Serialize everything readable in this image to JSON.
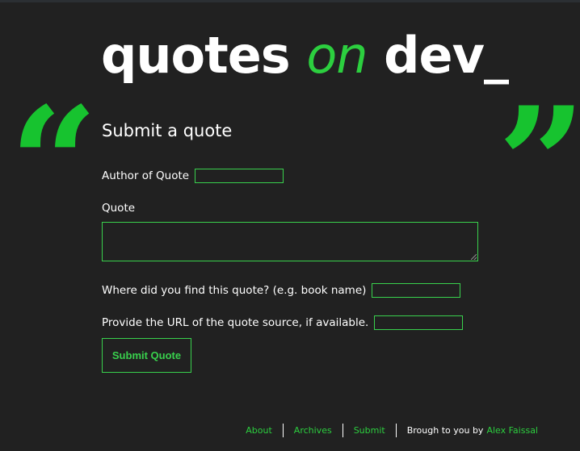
{
  "logo": {
    "word1": "quotes",
    "word2": "on",
    "word3": "dev_"
  },
  "icons": {
    "open_quote": "open-quote-icon",
    "close_quote": "close-quote-icon",
    "open_quote_glyph": "“",
    "close_quote_glyph": "”"
  },
  "colors": {
    "background": "#212121",
    "accent": "#2ccf3f",
    "text": "#ffffff"
  },
  "form": {
    "heading": "Submit a quote",
    "author_label": "Author of Quote",
    "author_value": "",
    "quote_label": "Quote",
    "quote_value": "",
    "source_label": "Where did you find this quote? (e.g. book name)",
    "source_value": "",
    "url_label": "Provide the URL of the quote source, if available.",
    "url_value": "",
    "submit_label": "Submit Quote"
  },
  "footer": {
    "links": [
      "About",
      "Archives",
      "Submit"
    ],
    "credit_text": "Brough to you by",
    "credit_name": "Alex Faissal"
  }
}
